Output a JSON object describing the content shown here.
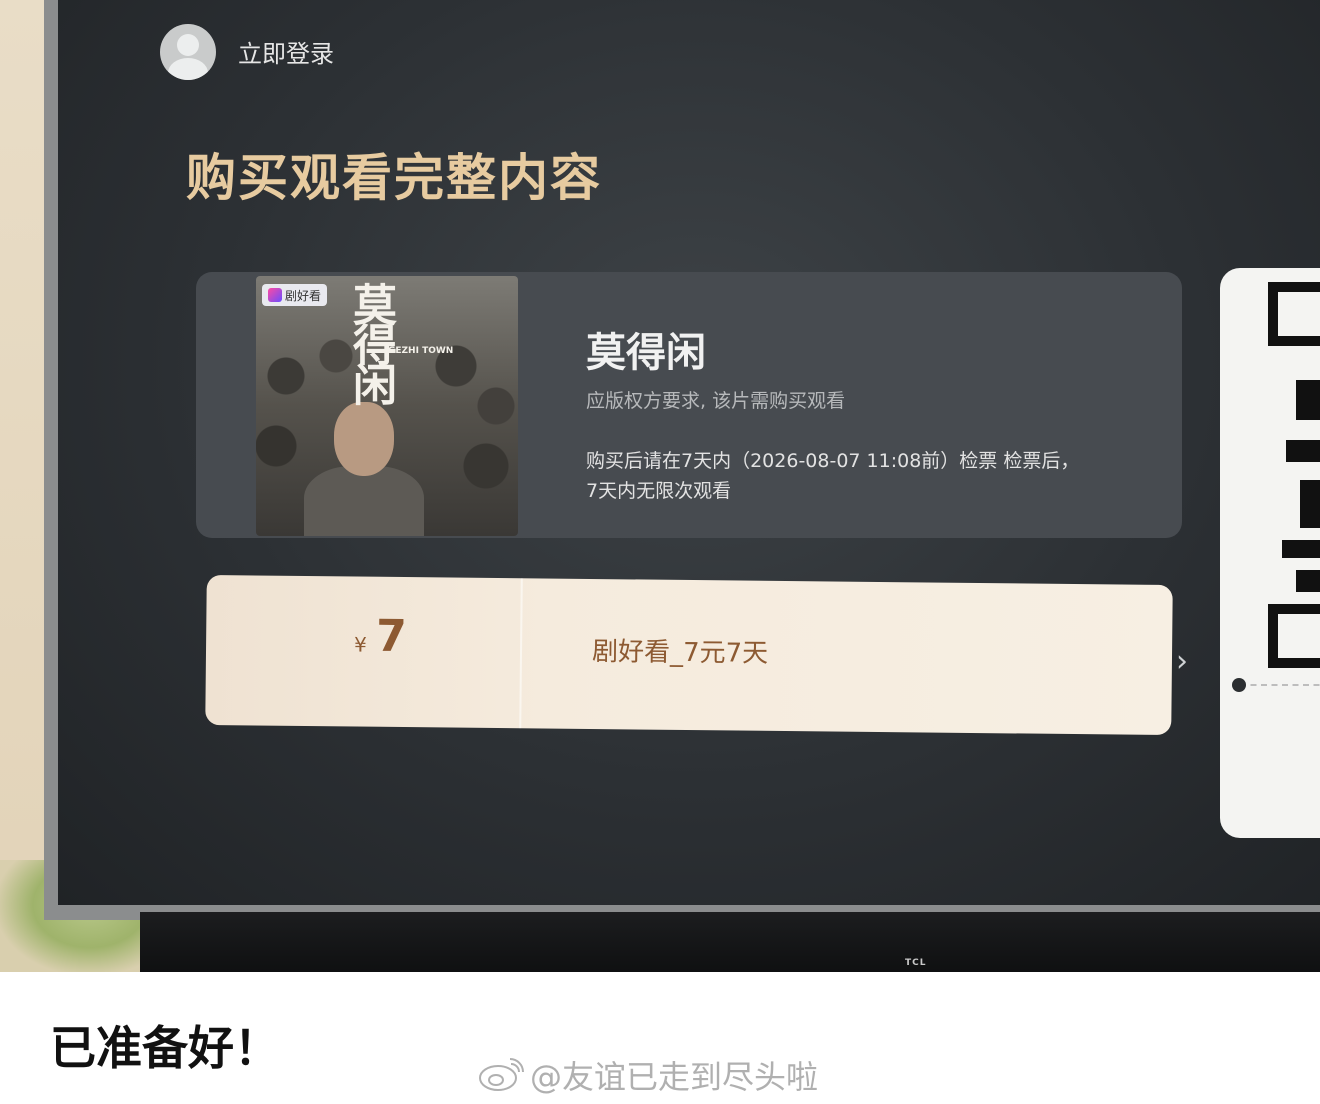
{
  "header": {
    "login_label": "立即登录"
  },
  "page": {
    "title": "购买观看完整内容"
  },
  "movie": {
    "poster_badge": "剧好看",
    "poster_title": "莫得闲",
    "poster_en": "GEZHI TOWN",
    "title": "莫得闲",
    "notice": "应版权方要求, 该片需购买观看",
    "detail": "购买后请在7天内（2026-08-07 11:08前）检票 检票后，7天内无限次观看"
  },
  "purchase": {
    "currency_symbol": "¥",
    "price": "7",
    "package_name": "剧好看_7元7天",
    "next_arrow": "›"
  },
  "device": {
    "brand": "TCL"
  },
  "post": {
    "caption": "已准备好！",
    "watermark": "@友谊已走到尽头啦"
  },
  "colors": {
    "title_gold": "#e7cba0",
    "price_brown": "#8d5a32",
    "screen_bg": "#2c3034"
  }
}
